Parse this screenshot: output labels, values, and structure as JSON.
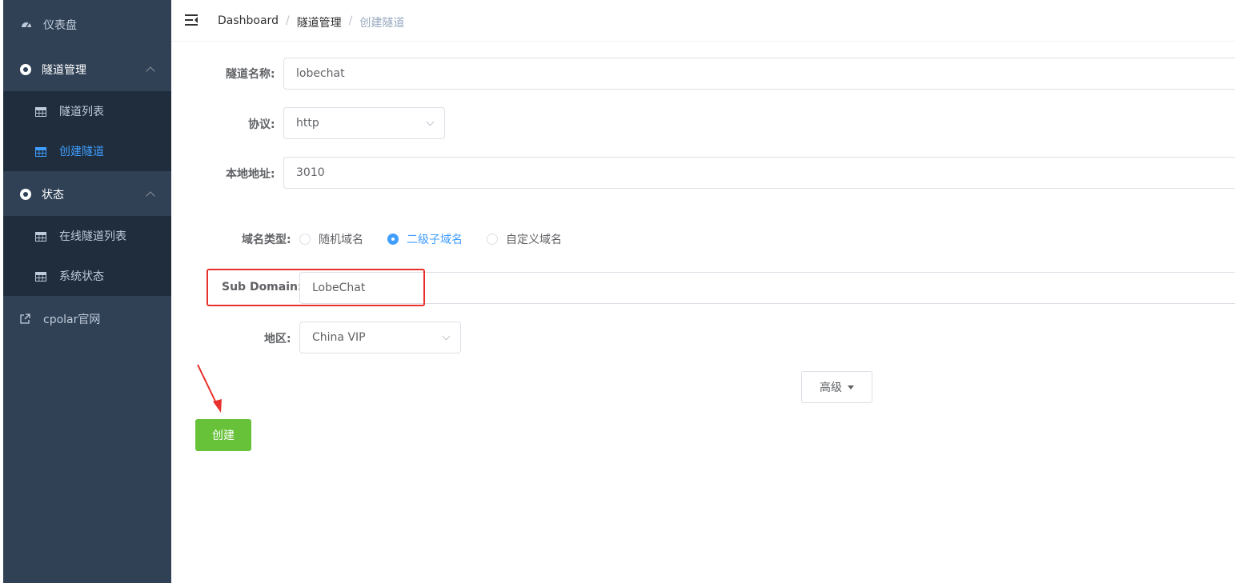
{
  "sidebar": {
    "items": [
      {
        "label": "仪表盘",
        "icon": "dashboard-icon"
      },
      {
        "label": "隧道管理",
        "icon": "circle-icon",
        "expanded": true,
        "children": [
          {
            "label": "隧道列表",
            "icon": "table-icon"
          },
          {
            "label": "创建隧道",
            "icon": "table-icon",
            "active": true
          }
        ]
      },
      {
        "label": "状态",
        "icon": "circle-icon",
        "expanded": true,
        "children": [
          {
            "label": "在线隧道列表",
            "icon": "table-icon"
          },
          {
            "label": "系统状态",
            "icon": "table-icon"
          }
        ]
      },
      {
        "label": "cpolar官网",
        "icon": "external-link-icon"
      }
    ]
  },
  "header": {
    "breadcrumb": [
      "Dashboard",
      "隧道管理",
      "创建隧道"
    ]
  },
  "form": {
    "tunnel_name": {
      "label": "隧道名称:",
      "value": "lobechat"
    },
    "protocol": {
      "label": "协议:",
      "value": "http"
    },
    "local_address": {
      "label": "本地地址:",
      "value": "3010"
    },
    "domain_type": {
      "label": "域名类型:",
      "options": [
        "随机域名",
        "二级子域名",
        "自定义域名"
      ],
      "selected": "二级子域名"
    },
    "sub_domain": {
      "label": "Sub Domain:",
      "value": "LobeChat"
    },
    "region": {
      "label": "地区:",
      "value": "China VIP"
    },
    "advanced_label": "高级",
    "create_label": "创建"
  },
  "colors": {
    "sidebar_bg": "#304156",
    "submenu_bg": "#1f2d3d",
    "active": "#409eff",
    "create_button": "#67c23a",
    "highlight": "#e8302c"
  }
}
